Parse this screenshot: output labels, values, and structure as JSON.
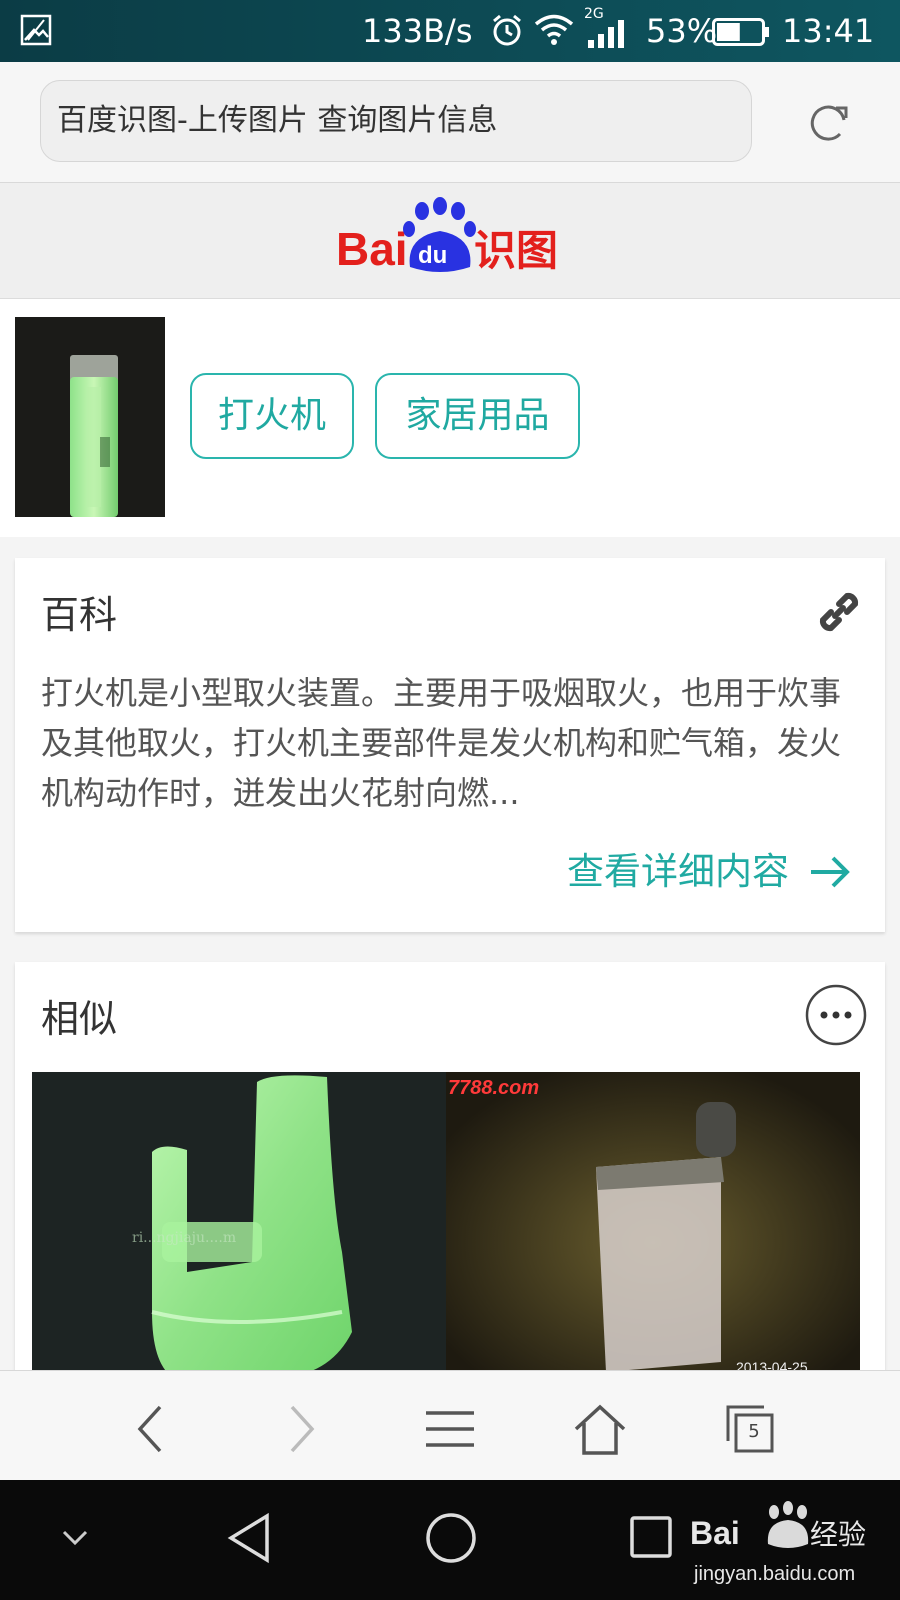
{
  "status_bar": {
    "net_speed": "133B/s",
    "network_type": "2G",
    "battery": "53%",
    "battery_level": 0.53,
    "time": "13:41"
  },
  "browser": {
    "url_title": "百度识图-上传图片 查询图片信息",
    "tab_count": "5"
  },
  "header": {
    "logo_text": "Baidu识图"
  },
  "result": {
    "tags": [
      "打火机",
      "家居用品"
    ]
  },
  "baike": {
    "title": "百科",
    "text": "打火机是小型取火装置。主要用于吸烟取火，也用于炊事及其他取火，打火机主要部件是发火机构和贮气箱，发火机构动作时，迸发出火花射向燃...",
    "more_label": "查看详细内容"
  },
  "similar": {
    "title": "相似",
    "images": [
      {
        "desc": "green-plastic-hook",
        "watermark": "ri...ngjiaju....m"
      },
      {
        "desc": "lighter-photo",
        "watermark": "7788.com",
        "date": "2013-04-25"
      }
    ]
  },
  "watermark": {
    "brand": "Baidu经验",
    "url": "jingyan.baidu.com"
  },
  "colors": {
    "accent": "#20a9a1",
    "statusbar": "#0d4c56",
    "baidu_red": "#e3201c",
    "baidu_blue": "#2932e1"
  }
}
